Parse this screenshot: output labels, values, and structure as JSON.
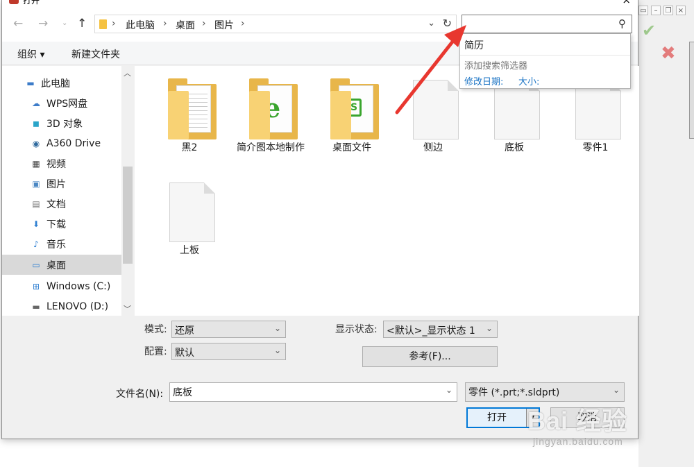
{
  "window": {
    "title": "打开",
    "close": "×"
  },
  "nav": {
    "back": "←",
    "forward": "→",
    "dropdown": "⌄",
    "up": "↑"
  },
  "breadcrumb": [
    "此电脑",
    "桌面",
    "图片"
  ],
  "search": {
    "value": "",
    "icon": "search-icon"
  },
  "search_dropdown": {
    "recent": "简历",
    "add_filter": "添加搜索筛选器",
    "modified_date": "修改日期:",
    "size": "大小:"
  },
  "toolbar": {
    "organize": "组织 ▾",
    "new_folder": "新建文件夹"
  },
  "sidebar": {
    "items": [
      {
        "label": "此电脑",
        "icon": "computer-icon"
      },
      {
        "label": "WPS网盘",
        "icon": "cloud-icon"
      },
      {
        "label": "3D 对象",
        "icon": "cube-icon"
      },
      {
        "label": "A360 Drive",
        "icon": "a360-icon"
      },
      {
        "label": "视频",
        "icon": "film-icon"
      },
      {
        "label": "图片",
        "icon": "picture-icon"
      },
      {
        "label": "文档",
        "icon": "document-icon"
      },
      {
        "label": "下载",
        "icon": "download-icon"
      },
      {
        "label": "音乐",
        "icon": "music-icon"
      },
      {
        "label": "桌面",
        "icon": "desktop-icon",
        "selected": true
      },
      {
        "label": "Windows (C:)",
        "icon": "drive-icon"
      },
      {
        "label": "LENOVO (D:)",
        "icon": "drive-icon"
      }
    ]
  },
  "files": [
    {
      "name": "黑2",
      "type": "folder-doc"
    },
    {
      "name": "简介图本地制作",
      "type": "folder-ie"
    },
    {
      "name": "桌面文件",
      "type": "folder-sheet"
    },
    {
      "name": "侧边",
      "type": "file"
    },
    {
      "name": "底板",
      "type": "file"
    },
    {
      "name": "零件1",
      "type": "file"
    },
    {
      "name": "上板",
      "type": "file"
    }
  ],
  "options": {
    "mode_label": "模式:",
    "mode_value": "还原",
    "config_label": "配置:",
    "config_value": "默认",
    "display_state_label": "显示状态:",
    "display_state_value": "<默认>_显示状态 1",
    "reference_button": "参考(F)..."
  },
  "filename": {
    "label": "文件名(N):",
    "value": "底板",
    "filter": "零件 (*.prt;*.sldprt)"
  },
  "actions": {
    "open": "打开",
    "cancel": "取消"
  },
  "watermark": {
    "text": "Bai 经验",
    "url": "jingyan.baidu.com"
  },
  "colors": {
    "accent": "#0078d7",
    "arrow": "#e8372f",
    "selected": "#d9d9d9",
    "folder": "#e8b64a"
  }
}
